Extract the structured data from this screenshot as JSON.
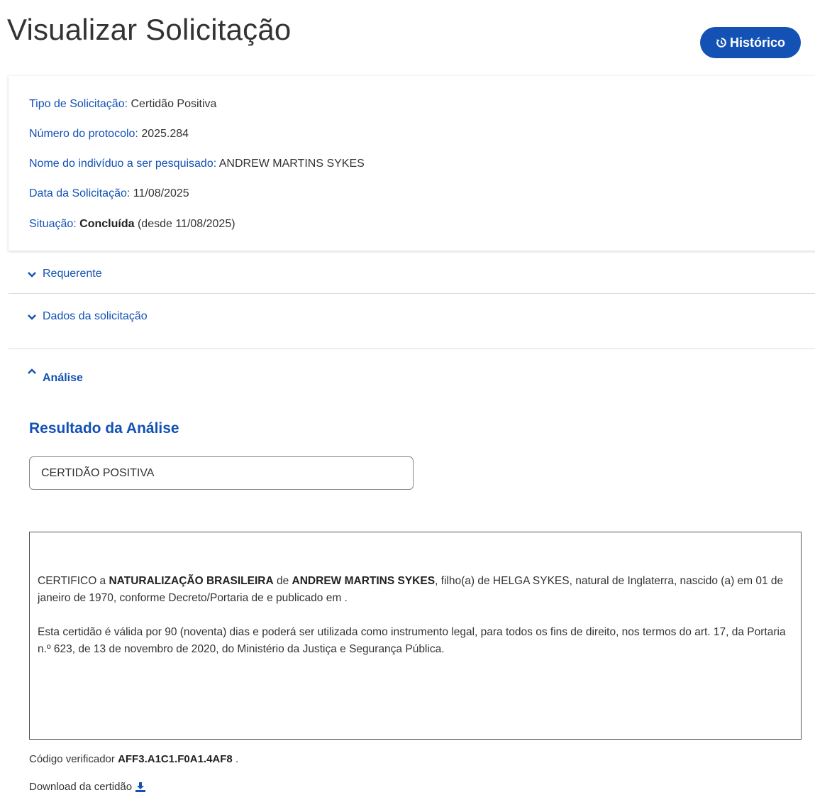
{
  "header": {
    "title": "Visualizar Solicitação",
    "history_button": "Histórico"
  },
  "info": {
    "tipo_label": "Tipo de Solicitação",
    "tipo_value": "Certidão Positiva",
    "protocolo_label": "Número do protocolo",
    "protocolo_value": "2025.284",
    "nome_label": "Nome do indivíduo a ser pesquisado",
    "nome_value": "ANDREW MARTINS SYKES",
    "data_label": "Data da Solicitação",
    "data_value": "11/08/2025",
    "situacao_label": "Situação",
    "situacao_value": "Concluída",
    "situacao_since": "(desde 11/08/2025)"
  },
  "sections": {
    "requerente": "Requerente",
    "dados": "Dados da solicitação",
    "analise": "Análise"
  },
  "analysis": {
    "title": "Resultado da Análise",
    "result_value": "CERTIDÃO POSITIVA",
    "cert_p1_pre": "CERTIFICO a ",
    "cert_p1_b1": "NATURALIZAÇÃO BRASILEIRA",
    "cert_p1_mid": " de ",
    "cert_p1_b2": "ANDREW MARTINS SYKES",
    "cert_p1_post": ", filho(a) de HELGA SYKES, natural de Inglaterra, nascido (a) em 01 de janeiro de 1970, conforme Decreto/Portaria de e publicado em .",
    "cert_p2": "Esta certidão é válida por 90 (noventa) dias e poderá ser utilizada como instrumento legal, para todos os fins de direito, nos termos do art. 17, da Portaria n.º 623, de 13 de novembro de 2020, do Ministério da Justiça e Segurança Pública.",
    "verif_label": "Código verificador ",
    "verif_code": "AFF3.A1C1.F0A1.4AF8",
    "verif_end": " .",
    "download_label": "Download da certidão"
  },
  "colors": {
    "primary": "#1351b4",
    "text": "#333333"
  },
  "icons": {
    "history": "history-icon",
    "chevron_down": "chevron-down-icon",
    "chevron_up": "chevron-up-icon",
    "download": "download-icon"
  }
}
